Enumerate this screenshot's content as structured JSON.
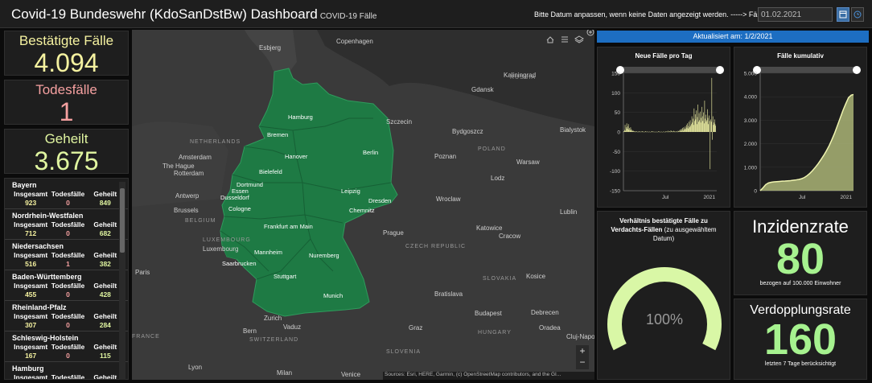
{
  "header": {
    "title": "Covid-19 Bundeswehr (KdoSanDstBw) Dashboard",
    "subtitle": "COVID-19 Fälle",
    "hint": "Bitte Datum anpassen, wenn keine Daten angezeigt werden. -----> Fälle am:",
    "date_value": "01.02.2021"
  },
  "stats": {
    "confirmed_label": "Bestätigte Fälle",
    "confirmed_value": "4.094",
    "deaths_label": "Todesfälle",
    "deaths_value": "1",
    "recovered_label": "Geheilt",
    "recovered_value": "3.675",
    "confirmed_color": "#f5f2a0",
    "deaths_color": "#f5a0a0",
    "recovered_color": "#e0f5a0"
  },
  "state_list": {
    "col_total": "Insgesamt",
    "col_deaths": "Todesfälle",
    "col_recovered": "Geheilt",
    "states": [
      {
        "name": "Bayern",
        "total": "923",
        "deaths": "0",
        "recovered": "849"
      },
      {
        "name": "Nordrhein-Westfalen",
        "total": "712",
        "deaths": "0",
        "recovered": "682"
      },
      {
        "name": "Niedersachsen",
        "total": "516",
        "deaths": "1",
        "recovered": "382"
      },
      {
        "name": "Baden-Württemberg",
        "total": "455",
        "deaths": "0",
        "recovered": "428"
      },
      {
        "name": "Rheinland-Pfalz",
        "total": "307",
        "deaths": "0",
        "recovered": "284"
      },
      {
        "name": "Schleswig-Holstein",
        "total": "167",
        "deaths": "0",
        "recovered": "115"
      },
      {
        "name": "Hamburg",
        "total": "",
        "deaths": "",
        "recovered": ""
      }
    ]
  },
  "map": {
    "attribution": "Sources: Esri, HERE, Garmin, (c) OpenStreetMap contributors, and the GI...",
    "cities": [
      {
        "name": "Copenhagen"
      },
      {
        "name": "Esbjerg"
      },
      {
        "name": "Kaliningrad"
      },
      {
        "name": "Gdansk"
      },
      {
        "name": "Szczecin"
      },
      {
        "name": "Bydgoszcz"
      },
      {
        "name": "Bialystok"
      },
      {
        "name": "Poznan"
      },
      {
        "name": "Warsaw"
      },
      {
        "name": "Lodz"
      },
      {
        "name": "Lublin"
      },
      {
        "name": "Wroclaw"
      },
      {
        "name": "Katowice"
      },
      {
        "name": "Cracow"
      },
      {
        "name": "Prague"
      },
      {
        "name": "Amsterdam"
      },
      {
        "name": "The Hague"
      },
      {
        "name": "Rotterdam"
      },
      {
        "name": "Antwerp"
      },
      {
        "name": "Brussels"
      },
      {
        "name": "Luxembourg"
      },
      {
        "name": "Paris"
      },
      {
        "name": "Zurich"
      },
      {
        "name": "Bern"
      },
      {
        "name": "Vaduz"
      },
      {
        "name": "Milan"
      },
      {
        "name": "Venice"
      },
      {
        "name": "Bratislava"
      },
      {
        "name": "Budapest"
      },
      {
        "name": "Debrecen"
      },
      {
        "name": "Oradea"
      },
      {
        "name": "Kosice"
      },
      {
        "name": "Graz"
      },
      {
        "name": "Cluj-Napoca"
      },
      {
        "name": "Lyon"
      }
    ],
    "de_cities": [
      {
        "name": "Hamburg"
      },
      {
        "name": "Bremen"
      },
      {
        "name": "Hanover"
      },
      {
        "name": "Berlin"
      },
      {
        "name": "Bielefeld"
      },
      {
        "name": "Dortmund"
      },
      {
        "name": "Essen"
      },
      {
        "name": "Dusseldorf"
      },
      {
        "name": "Cologne"
      },
      {
        "name": "Leipzig"
      },
      {
        "name": "Dresden"
      },
      {
        "name": "Chemnitz"
      },
      {
        "name": "Frankfurt am Main"
      },
      {
        "name": "Mannheim"
      },
      {
        "name": "Nuremberg"
      },
      {
        "name": "Saarbrucken"
      },
      {
        "name": "Stuttgart"
      },
      {
        "name": "Munich"
      }
    ],
    "countries": [
      {
        "name": "POLAND"
      },
      {
        "name": "NETHERLANDS"
      },
      {
        "name": "BELGIUM"
      },
      {
        "name": "LUXEMBOURG"
      },
      {
        "name": "CZECH REPUBLIC"
      },
      {
        "name": "SLOVAKIA"
      },
      {
        "name": "HUNGARY"
      },
      {
        "name": "SLOVENIA"
      },
      {
        "name": "SWITZERLAND"
      },
      {
        "name": "FRANCE"
      },
      {
        "name": "RUSSIA"
      }
    ],
    "land_color": "#1e7a44"
  },
  "updated": "Aktualisiert am: 1/2/2021",
  "chart_data": [
    {
      "type": "bar",
      "title": "Neue Fälle pro Tag",
      "yticks": [
        150,
        100,
        50,
        0,
        -50,
        -100,
        -150
      ],
      "xticks": [
        "Jul",
        "2021"
      ],
      "ylim": [
        -150,
        150
      ],
      "x": [
        0,
        2,
        4,
        6,
        8,
        10,
        12,
        14,
        16,
        18,
        20,
        22,
        24,
        26,
        28,
        30,
        32,
        34,
        36,
        38,
        40,
        42,
        44,
        46,
        48,
        50,
        52,
        54,
        56,
        58,
        60,
        62,
        64,
        66,
        68,
        70,
        72,
        74,
        76,
        78,
        80,
        82,
        84,
        86,
        88,
        90,
        92,
        94,
        96,
        98,
        100,
        102,
        104,
        106,
        108,
        110,
        112,
        114,
        116,
        118,
        120,
        122,
        124,
        126,
        128,
        130,
        132,
        134,
        136,
        138,
        140,
        142,
        144,
        146,
        148,
        150,
        152,
        154,
        156,
        158,
        160,
        162,
        164,
        166,
        168,
        170,
        172,
        174,
        176,
        178,
        180,
        182,
        184,
        186,
        188,
        190,
        192,
        194,
        196,
        198,
        200,
        202,
        204,
        206,
        208,
        210,
        212,
        214,
        216,
        218,
        220,
        222,
        224,
        226,
        228,
        230,
        232,
        234,
        236,
        238,
        240,
        242,
        244,
        246,
        248,
        250,
        252,
        254,
        256,
        258,
        260,
        262,
        264,
        266,
        268,
        270,
        272,
        274,
        276,
        278,
        280,
        282,
        284,
        286,
        288,
        290,
        292,
        294,
        296,
        298,
        300,
        302,
        304,
        306,
        308,
        310,
        312,
        314,
        316,
        318,
        320,
        322,
        324,
        326,
        328,
        330,
        332,
        334,
        336,
        338
      ],
      "values": [
        0,
        2,
        5,
        18,
        3,
        12,
        22,
        8,
        14,
        20,
        6,
        10,
        4,
        12,
        7,
        3,
        5,
        2,
        3,
        1,
        2,
        0,
        1,
        2,
        1,
        0,
        1,
        0,
        2,
        1,
        0,
        1,
        0,
        1,
        2,
        0,
        1,
        0,
        1,
        0,
        2,
        1,
        0,
        1,
        0,
        1,
        0,
        1,
        0,
        0,
        1,
        0,
        2,
        1,
        0,
        1,
        0,
        1,
        0,
        0,
        1,
        0,
        0,
        1,
        2,
        0,
        1,
        0,
        0,
        1,
        0,
        0,
        1,
        0,
        1,
        0,
        0,
        2,
        1,
        0,
        1,
        3,
        0,
        1,
        2,
        0,
        4,
        1,
        2,
        0,
        1,
        3,
        2,
        0,
        1,
        0,
        2,
        1,
        0,
        3,
        2,
        1,
        4,
        6,
        2,
        8,
        5,
        10,
        3,
        12,
        6,
        9,
        14,
        7,
        18,
        11,
        22,
        9,
        15,
        26,
        12,
        30,
        16,
        20,
        40,
        24,
        34,
        18,
        60,
        28,
        45,
        32,
        55,
        20,
        38,
        70,
        26,
        48,
        30,
        52,
        24,
        36,
        64,
        40,
        28,
        50,
        22,
        80,
        34,
        44,
        26,
        30,
        58,
        36,
        20,
        42,
        28,
        -95,
        32,
        26,
        138,
        -20,
        40,
        18,
        24,
        32,
        20,
        16
      ],
      "color": "#f5f7a8"
    },
    {
      "type": "area",
      "title": "Fälle kumulativ",
      "yticks": [
        "5.000",
        "4.000",
        "3.000",
        "2.000",
        "1.000",
        "0"
      ],
      "xticks": [
        "Jul",
        "2021"
      ],
      "ylim": [
        0,
        5000
      ],
      "x": [
        0,
        10,
        20,
        30,
        40,
        50,
        60,
        70,
        80,
        90,
        100,
        110,
        120,
        130,
        140,
        150,
        160,
        170,
        180,
        190,
        200,
        210,
        220,
        230,
        240,
        250,
        260,
        270,
        280,
        290,
        300,
        310,
        320,
        330,
        338
      ],
      "values": [
        0,
        120,
        260,
        330,
        360,
        375,
        385,
        395,
        405,
        410,
        420,
        430,
        445,
        460,
        480,
        510,
        560,
        640,
        740,
        860,
        1000,
        1150,
        1320,
        1500,
        1700,
        1920,
        2180,
        2460,
        2780,
        3100,
        3420,
        3700,
        3960,
        4070,
        4094
      ],
      "color": "#b3bd7a"
    }
  ],
  "gauge": {
    "title": "Verhältnis bestätigte Fälle zu Verdachts-Fällen",
    "subtitle": "(zu ausgewähltem Datum)",
    "value_text": "100%",
    "value": 1.0,
    "color": "#d9f7a6"
  },
  "incidence": {
    "label": "Inzidenzrate",
    "value": "80",
    "caption": "bezogen auf 100.000 Einwohner",
    "color": "#a6f28f"
  },
  "doubling": {
    "label": "Verdopplungsrate",
    "value": "160",
    "caption": "letzten 7 Tage berücksichtigt",
    "color": "#a6f28f"
  }
}
